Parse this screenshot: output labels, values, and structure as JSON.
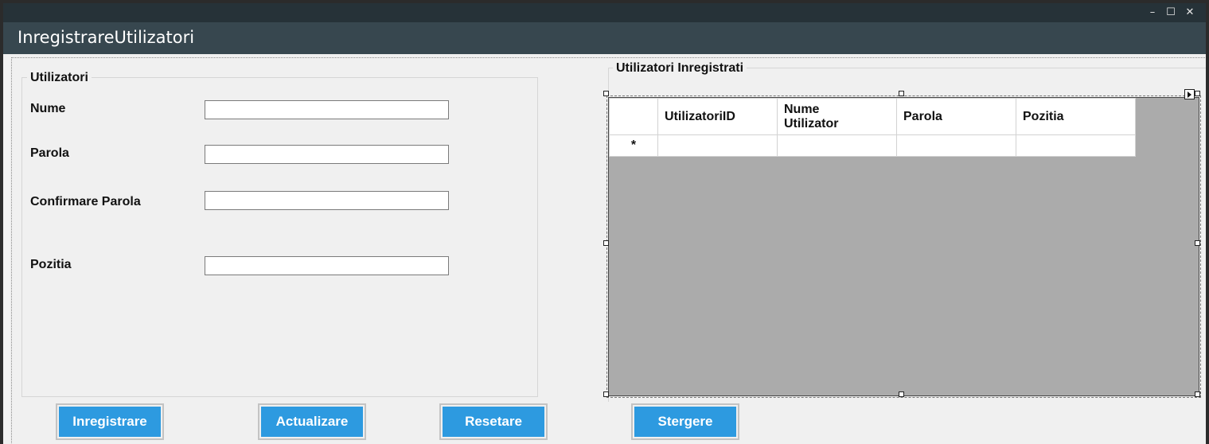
{
  "window": {
    "title": "InregistrareUtilizatori",
    "controls": {
      "minimize": "–",
      "maximize": "☐",
      "close": "✕"
    }
  },
  "user_group": {
    "legend": "Utilizatori",
    "fields": [
      {
        "label": "Nume",
        "value": "",
        "placeholder": ""
      },
      {
        "label": "Parola",
        "value": "",
        "placeholder": ""
      },
      {
        "label": "Confirmare Parola",
        "value": "",
        "placeholder": ""
      },
      {
        "label": "Pozitia",
        "value": "",
        "placeholder": ""
      }
    ]
  },
  "grid_group": {
    "legend": "Utilizatori Inregistrati",
    "columns": [
      "UtilizatoriID",
      "Nume Utilizator",
      "Parola",
      "Pozitia"
    ],
    "new_row_marker": "*"
  },
  "buttons": {
    "register": "Inregistrare",
    "update": "Actualizare",
    "reset": "Resetare",
    "delete": "Stergere"
  },
  "colors": {
    "topbar": "#263238",
    "titlebar": "#37474f",
    "button": "#2d9ae0",
    "grid_background": "#ababab"
  }
}
